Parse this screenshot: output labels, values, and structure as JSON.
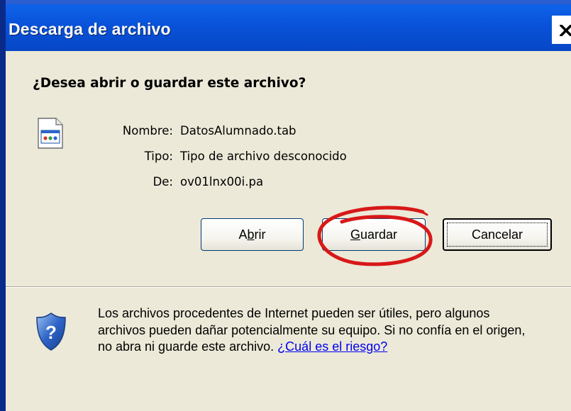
{
  "window": {
    "title": "Descarga de archivo",
    "close_label": "×"
  },
  "dialog": {
    "question": "¿Desea abrir o guardar este archivo?",
    "file": {
      "name_label": "Nombre:",
      "name_value": "DatosAlumnado.tab",
      "type_label": "Tipo:",
      "type_value": "Tipo de archivo desconocido",
      "from_label": "De:",
      "from_value": "ov01lnx00i.pa"
    },
    "buttons": {
      "open": {
        "prefix": "A",
        "accel": "b",
        "suffix": "rir"
      },
      "save": {
        "prefix": "",
        "accel": "G",
        "suffix": "uardar"
      },
      "cancel": "Cancelar"
    },
    "warning_text": "Los archivos procedentes de Internet pueden ser útiles, pero algunos archivos pueden dañar potencialmente su equipo. Si no confía en el origen, no abra ni guarde este archivo. ",
    "risk_link": "¿Cuál es el riesgo?"
  },
  "colors": {
    "titlebar": "#0852d8",
    "dialog_bg": "#ece9d8",
    "highlight_ring": "#d81818",
    "link": "#0000ee",
    "shield": "#2f64c8"
  },
  "icons": {
    "file": "unknown-file-icon",
    "shield": "security-shield-question-icon",
    "close": "close-icon"
  }
}
